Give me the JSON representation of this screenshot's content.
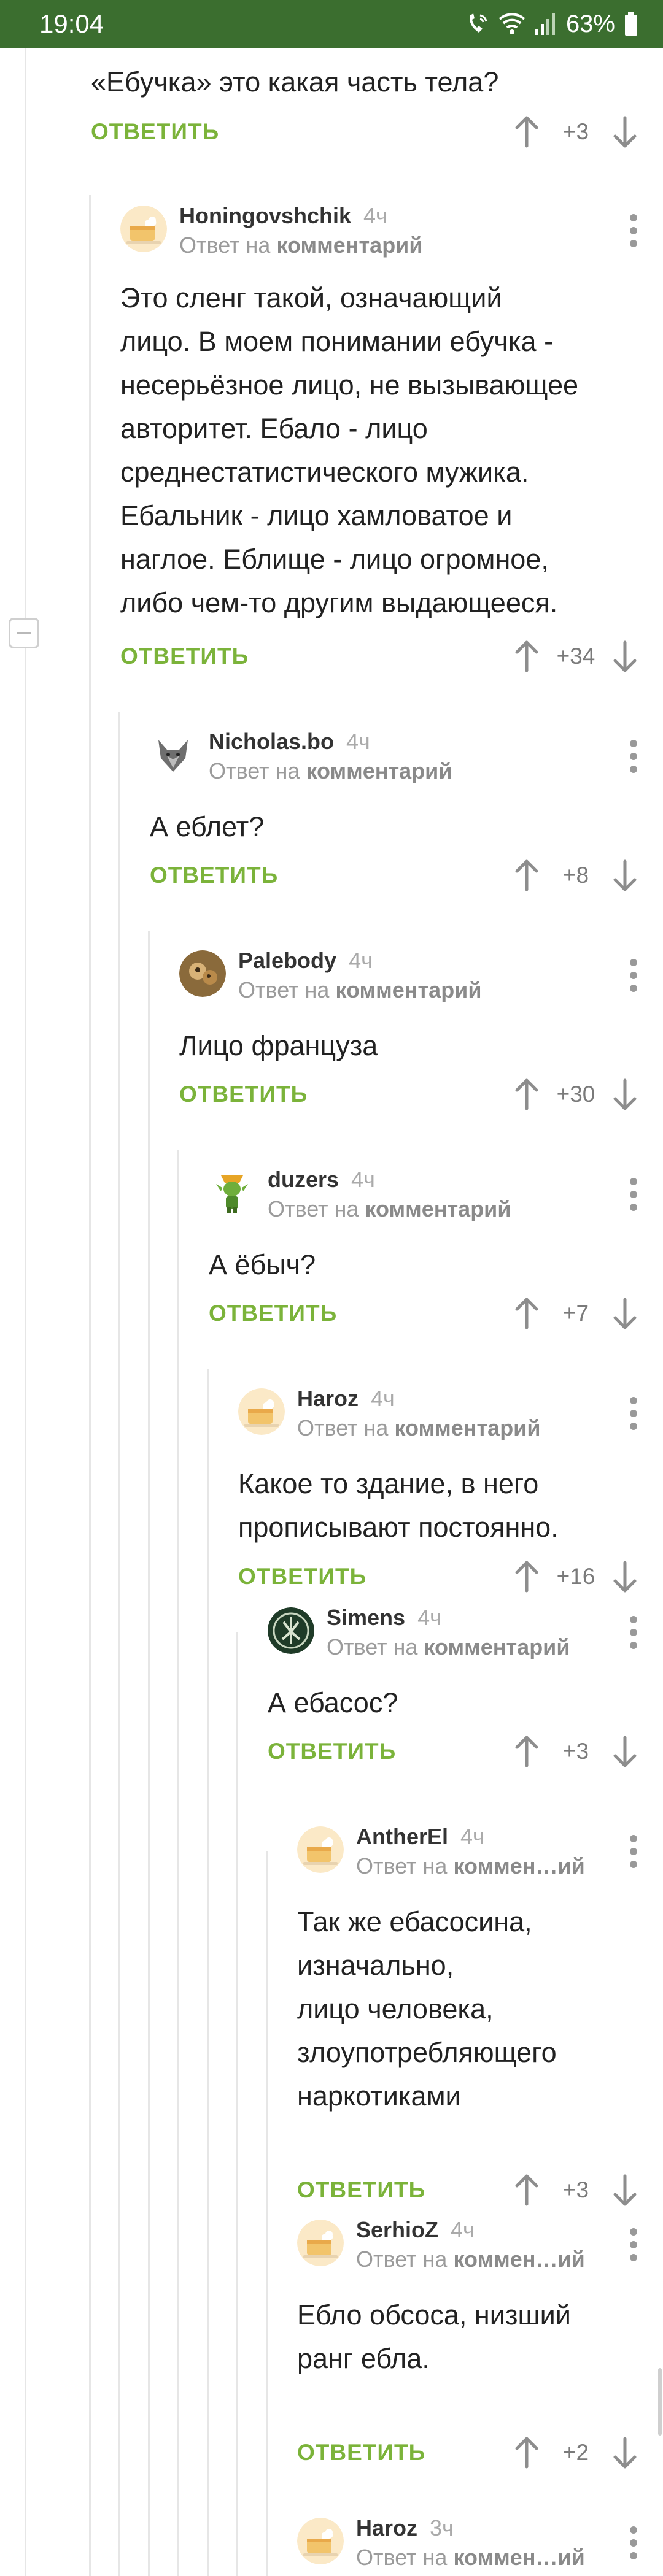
{
  "status_bar": {
    "time": "19:04",
    "battery": "63%"
  },
  "top": {
    "text": "«Ебучка» это какая часть тела?",
    "reply_label": "ОТВЕТИТЬ",
    "votes": "+3"
  },
  "comments": [
    {
      "username": "Honingovshchik",
      "time": "4ч",
      "reply_prefix": "Ответ на",
      "reply_target": "комментарий",
      "lines": [
        "Это сленг такой, означающий",
        "лицо. В моем понимании ебучка -",
        "несерьёзное лицо, не вызывающее",
        "авторитет. Ебало - лицо",
        "среднестатистического мужика.",
        "Ебальник - лицо хамловатое и",
        "наглое. Еблище - лицо огромное,",
        "либо чем-то другим выдающееся."
      ],
      "reply_label": "ОТВЕТИТЬ",
      "votes": "+34",
      "avatar": "pikabu-default-avatar"
    },
    {
      "username": "Nicholas.bo",
      "time": "4ч",
      "reply_prefix": "Ответ на",
      "reply_target": "комментарий",
      "lines": [
        "А еблет?"
      ],
      "reply_label": "ОТВЕТИТЬ",
      "votes": "+8",
      "avatar": "wolf-avatar"
    },
    {
      "username": "Palebody",
      "time": "4ч",
      "reply_prefix": "Ответ на",
      "reply_target": "комментарий",
      "lines": [
        "Лицо француза"
      ],
      "reply_label": "ОТВЕТИТЬ",
      "votes": "+30",
      "avatar": "photo-avatar"
    },
    {
      "username": "duzers",
      "time": "4ч",
      "reply_prefix": "Ответ на",
      "reply_target": "комментарий",
      "lines": [
        "А ёбыч?"
      ],
      "reply_label": "ОТВЕТИТЬ",
      "votes": "+7",
      "avatar": "goblin-avatar"
    },
    {
      "username": "Haroz",
      "time": "4ч",
      "reply_prefix": "Ответ на",
      "reply_target": "комментарий",
      "lines": [
        "Какое то здание, в него",
        "прописывают постоянно."
      ],
      "reply_label": "ОТВЕТИТЬ",
      "votes": "+16",
      "avatar": "pikabu-default-avatar"
    },
    {
      "username": "Simens",
      "time": "4ч",
      "reply_prefix": "Ответ на",
      "reply_target": "комментарий",
      "lines": [
        "А ебасос?"
      ],
      "reply_label": "ОТВЕТИТЬ",
      "votes": "+3",
      "avatar": "emblem-avatar"
    },
    {
      "username": "AntherEl",
      "time": "4ч",
      "reply_prefix": "Ответ на",
      "reply_target": "коммен…ий",
      "lines": [
        "Так же ебасосина,",
        "изначально,",
        "лицо человека,",
        "злоупотребляющего",
        "наркотиками"
      ],
      "reply_label": "ОТВЕТИТЬ",
      "votes": "+3",
      "avatar": "pikabu-default-avatar"
    },
    {
      "username": "SerhioZ",
      "time": "4ч",
      "reply_prefix": "Ответ на",
      "reply_target": "коммен…ий",
      "lines": [
        "Ебло обсоса, низший",
        "ранг ебла."
      ],
      "reply_label": "ОТВЕТИТЬ",
      "votes": "+2",
      "avatar": "pikabu-default-avatar"
    },
    {
      "username": "Haroz",
      "time": "3ч",
      "reply_prefix": "Ответ на",
      "reply_target": "коммен…ий",
      "lines": [],
      "reply_label": "",
      "votes": "",
      "avatar": "pikabu-default-avatar"
    }
  ]
}
